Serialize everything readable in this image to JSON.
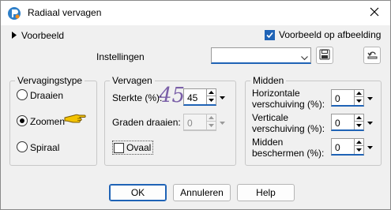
{
  "window": {
    "title": "Radiaal vervagen"
  },
  "top": {
    "preview_label": "Voorbeeld",
    "preview_on_image_label": "Voorbeeld op afbeelding",
    "preview_on_image_checked": true,
    "settings_label": "Instellingen",
    "settings_value": ""
  },
  "blur_type": {
    "title": "Vervagingstype",
    "options": [
      "Draaien",
      "Zoomen",
      "Spiraal"
    ],
    "selected": "Zoomen"
  },
  "blur": {
    "title": "Vervagen",
    "strength_label": "Sterkte (%):",
    "strength_value": "45",
    "strength_annotation": "45",
    "twist_label": "Graden draaien:",
    "twist_value": "0",
    "oval_label": "Ovaal",
    "oval_checked": false
  },
  "center": {
    "title": "Midden",
    "h_offset_label_1": "Horizontale",
    "h_offset_label_2": "verschuiving (%):",
    "h_offset_value": "0",
    "v_offset_label_1": "Verticale",
    "v_offset_label_2": "verschuiving (%):",
    "v_offset_value": "0",
    "protect_label_1": "Midden",
    "protect_label_2": "beschermen (%):",
    "protect_value": "0"
  },
  "buttons": {
    "ok": "OK",
    "cancel": "Annuleren",
    "help": "Help"
  },
  "colors": {
    "accent": "#1f63b6",
    "annotation": "#7a5fa8",
    "pointer": "#f2c200"
  }
}
